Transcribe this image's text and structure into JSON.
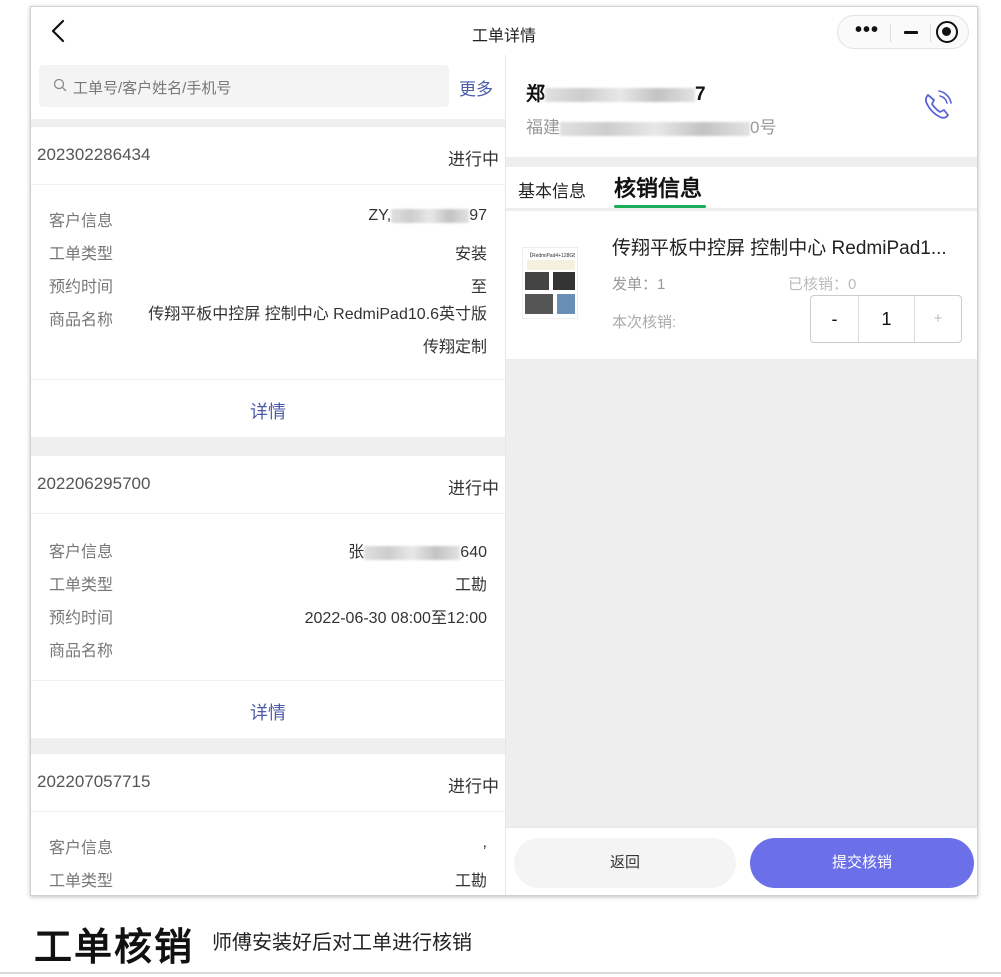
{
  "window": {
    "title": "工单详情",
    "capsule_more": "•••"
  },
  "search": {
    "placeholder": "工单号/客户姓名/手机号",
    "more_label": "更多"
  },
  "orders": [
    {
      "order_no": "202302286434",
      "status": "进行中",
      "labels": [
        "客户信息",
        "工单类型",
        "预约时间",
        "商品名称"
      ],
      "customer_prefix": "ZY,",
      "customer_suffix": "97",
      "type": "安装",
      "appointment": "至",
      "product": "传翔平板中控屏 控制中心 RedmiPad10.6英寸版 传翔定制",
      "detail_label": "详情"
    },
    {
      "order_no": "202206295700",
      "status": "进行中",
      "labels": [
        "客户信息",
        "工单类型",
        "预约时间",
        "商品名称"
      ],
      "customer_prefix": "张",
      "customer_suffix": "640",
      "type": "工勘",
      "appointment": "2022-06-30 08:00至12:00",
      "product": "",
      "detail_label": "详情"
    },
    {
      "order_no": "202207057715",
      "status": "进行中",
      "labels": [
        "客户信息",
        "工单类型"
      ],
      "customer_prefix": ",",
      "customer_suffix": "",
      "type": "工勘"
    }
  ],
  "customer": {
    "name_prefix": "郑",
    "name_suffix": "7",
    "addr_prefix": "福建",
    "addr_suffix": "0号"
  },
  "tabs": {
    "basic": "基本信息",
    "verify": "核销信息"
  },
  "product": {
    "name": "传翔平板中控屏 控制中心 RedmiPad1...",
    "thumb_text": "【RedmiPad4+128GB套餐】",
    "issued": "发单：1",
    "verified": "已核销：0",
    "this_label": "本次核销:",
    "stepper_minus": "-",
    "stepper_value": "1",
    "stepper_plus": "+"
  },
  "actions": {
    "back": "返回",
    "submit": "提交核销"
  },
  "caption": {
    "title": "工单核销",
    "subtitle": "师傅安装好后对工单进行核销"
  },
  "colors": {
    "accent": "#6b70e8",
    "link": "#4a5ba8",
    "tab_underline": "#1aad5a"
  }
}
